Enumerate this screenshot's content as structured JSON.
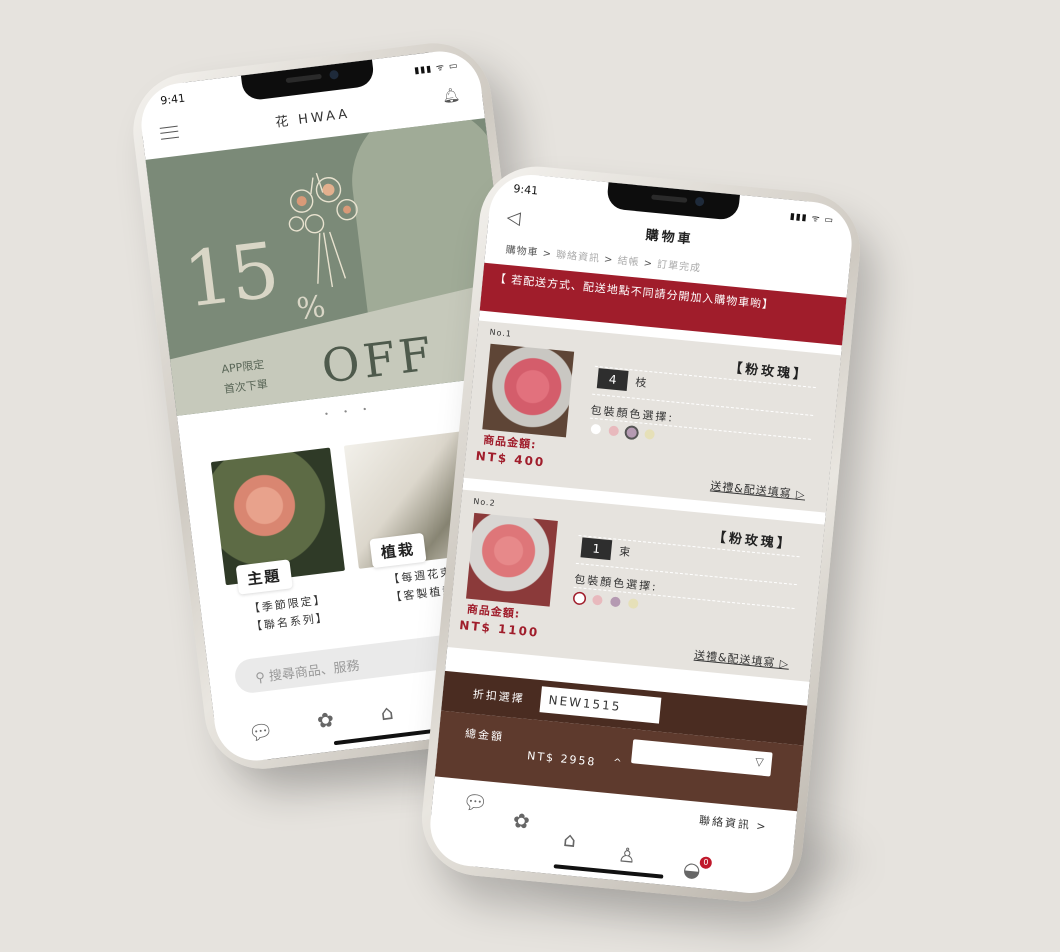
{
  "status_bar": {
    "time": "9:41",
    "signal": "▮▮▮ ᯤ ▭"
  },
  "home": {
    "title": "花 HWAA",
    "banner": {
      "number": "15",
      "percent": "%",
      "off": "OFF",
      "line1": "APP限定",
      "line2": "首次下單"
    },
    "carousel_dots": "• • •",
    "categories": [
      {
        "label": "主題",
        "subs": [
          "【季節限定】",
          "【聯名系列】"
        ]
      },
      {
        "label": "植栽",
        "subs": [
          "【每週花束】",
          "【客製植栽】"
        ]
      }
    ],
    "search_placeholder": "搜尋商品、服務",
    "icons": {
      "menu": "menu-icon",
      "bell": "bell-icon",
      "search": "search-icon",
      "chat": "chat-icon",
      "flower": "flower-icon",
      "bag": "bag-icon"
    }
  },
  "cart": {
    "title": "購物車",
    "breadcrumb": {
      "current": "購物車",
      "step2": "聯絡資訊",
      "step3": "結帳",
      "step4": "訂單完成"
    },
    "notice": "【 若配送方式、配送地點不同請分開加入購物車喲】",
    "items": [
      {
        "no": "No.1",
        "name": "【粉玫瑰】",
        "qty": "4",
        "unit": "枝",
        "package_label": "包裝顏色選擇:",
        "price_label": "商品金額:",
        "price": "NT$  400",
        "gift_link": "送禮&配送填寫 ▷"
      },
      {
        "no": "No.2",
        "name": "【粉玫瑰】",
        "qty": "1",
        "unit": "束",
        "package_label": "包裝顏色選擇:",
        "price_label": "商品金額:",
        "price": "NT$ 1100",
        "gift_link": "送禮&配送填寫 ▷"
      }
    ],
    "swatch_colors": [
      "#ffffff",
      "#e8b9bd",
      "#b59ab2",
      "#e6e0b8"
    ],
    "discount_label": "折扣選擇",
    "discount_code": "NEW1515",
    "total_label": "總金額",
    "total_amount": "NT$ 2958",
    "total_caret": "^",
    "contact_link": "聯絡資訊 >",
    "cart_badge": "0",
    "accent_color": "#a01d2b",
    "footer_color": "#5e3a2d"
  }
}
